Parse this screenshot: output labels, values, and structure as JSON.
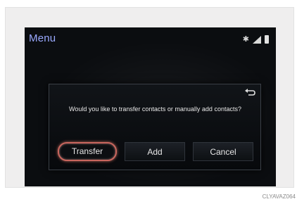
{
  "screen": {
    "title": "Menu",
    "status_icons": [
      "bluetooth-icon",
      "signal-icon",
      "battery-icon"
    ],
    "accent_color": "#9aa9ff"
  },
  "dialog": {
    "message": "Would you like to transfer contacts or manually add contacts?",
    "buttons": {
      "transfer": "Transfer",
      "add": "Add",
      "cancel": "Cancel"
    },
    "back_icon": "back-arrow-icon",
    "selected_button_color": "#c9665e"
  },
  "caption": "CLYAVAZ064"
}
